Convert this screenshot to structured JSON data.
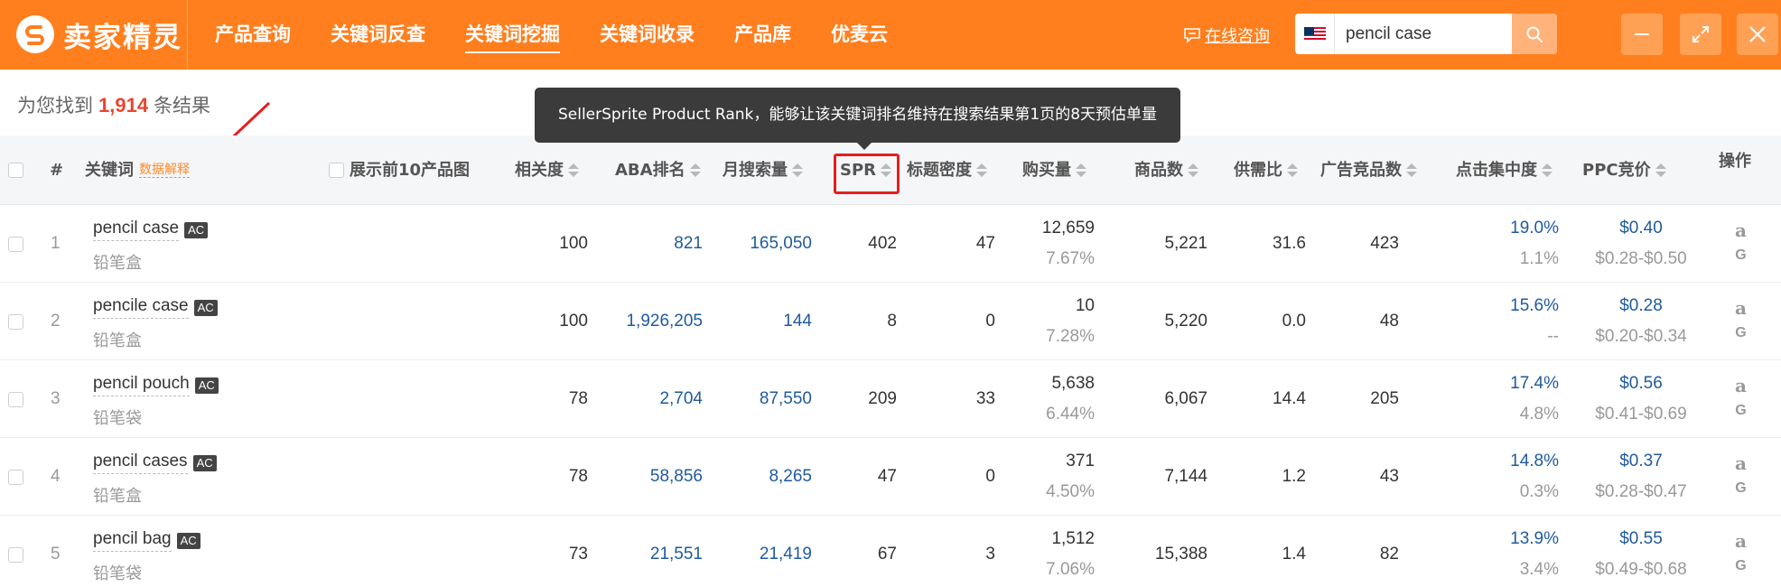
{
  "header": {
    "logo_text": "卖家精灵",
    "nav": [
      "产品查询",
      "关键词反查",
      "关键词挖掘",
      "关键词收录",
      "产品库",
      "优麦云"
    ],
    "active_nav_index": 2,
    "consult": "在线咨询",
    "search_value": "pencil case",
    "accent_color": "#ff7f1e"
  },
  "result": {
    "prefix": "为您找到",
    "count": "1,914",
    "suffix": "条结果"
  },
  "tooltip": "SellerSprite Product Rank，能够让该关键词排名维持在搜索结果第1页的8天预估单量",
  "table": {
    "headers": {
      "index": "#",
      "keyword": "关键词",
      "data_explain": "数据解释",
      "show_top10": "展示前10产品图",
      "relevance": "相关度",
      "aba_rank": "ABA排名",
      "monthly_search": "月搜索量",
      "spr": "SPR",
      "title_density": "标题密度",
      "purchases": "购买量",
      "products": "商品数",
      "supply_demand": "供需比",
      "ad_competitors": "广告竞品数",
      "click_concentration": "点击集中度",
      "ppc": "PPC竞价",
      "actions": "操作"
    },
    "rows": [
      {
        "index": "1",
        "keyword": "pencil case",
        "badge": "AC",
        "translation": "铅笔盒",
        "relevance": "100",
        "aba_rank": "821",
        "monthly_search": "165,050",
        "spr": "402",
        "title_density": "47",
        "purchases": "12,659",
        "purchase_rate": "7.67%",
        "products": "5,221",
        "supply_demand": "31.6",
        "ad_competitors": "423",
        "click_concentration": "19.0%",
        "conversion": "1.1%",
        "ppc": "$0.40",
        "ppc_range": "$0.28-$0.50"
      },
      {
        "index": "2",
        "keyword": "pencile case",
        "badge": "AC",
        "translation": "铅笔盒",
        "relevance": "100",
        "aba_rank": "1,926,205",
        "monthly_search": "144",
        "spr": "8",
        "title_density": "0",
        "purchases": "10",
        "purchase_rate": "7.28%",
        "products": "5,220",
        "supply_demand": "0.0",
        "ad_competitors": "48",
        "click_concentration": "15.6%",
        "conversion": "--",
        "ppc": "$0.28",
        "ppc_range": "$0.20-$0.34"
      },
      {
        "index": "3",
        "keyword": "pencil pouch",
        "badge": "AC",
        "translation": "铅笔袋",
        "relevance": "78",
        "aba_rank": "2,704",
        "monthly_search": "87,550",
        "spr": "209",
        "title_density": "33",
        "purchases": "5,638",
        "purchase_rate": "6.44%",
        "products": "6,067",
        "supply_demand": "14.4",
        "ad_competitors": "205",
        "click_concentration": "17.4%",
        "conversion": "4.8%",
        "ppc": "$0.56",
        "ppc_range": "$0.41-$0.69"
      },
      {
        "index": "4",
        "keyword": "pencil cases",
        "badge": "AC",
        "translation": "铅笔盒",
        "relevance": "78",
        "aba_rank": "58,856",
        "monthly_search": "8,265",
        "spr": "47",
        "title_density": "0",
        "purchases": "371",
        "purchase_rate": "4.50%",
        "products": "7,144",
        "supply_demand": "1.2",
        "ad_competitors": "43",
        "click_concentration": "14.8%",
        "conversion": "0.3%",
        "ppc": "$0.37",
        "ppc_range": "$0.28-$0.47"
      },
      {
        "index": "5",
        "keyword": "pencil bag",
        "badge": "AC",
        "translation": "铅笔袋",
        "relevance": "73",
        "aba_rank": "21,551",
        "monthly_search": "21,419",
        "spr": "67",
        "title_density": "3",
        "purchases": "1,512",
        "purchase_rate": "7.06%",
        "products": "15,388",
        "supply_demand": "1.4",
        "ad_competitors": "82",
        "click_concentration": "13.9%",
        "conversion": "3.4%",
        "ppc": "$0.55",
        "ppc_range": "$0.49-$0.68"
      }
    ],
    "action_icons": [
      "amazon-icon",
      "google-icon"
    ],
    "action_labels": {
      "amazon": "a",
      "google": "G"
    }
  }
}
